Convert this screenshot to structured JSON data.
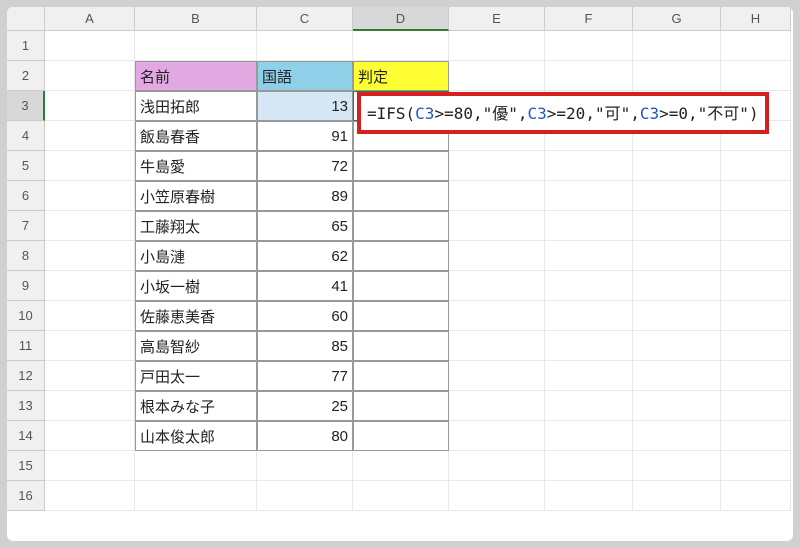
{
  "columns": [
    "A",
    "B",
    "C",
    "D",
    "E",
    "F",
    "G",
    "H"
  ],
  "rows": [
    "1",
    "2",
    "3",
    "4",
    "5",
    "6",
    "7",
    "8",
    "9",
    "10",
    "11",
    "12",
    "13",
    "14",
    "15",
    "16"
  ],
  "active_column": "D",
  "active_row": "3",
  "headers": {
    "name": "名前",
    "score": "国語",
    "judge": "判定"
  },
  "table": [
    {
      "name": "浅田拓郎",
      "score": "13"
    },
    {
      "name": "飯島春香",
      "score": "91"
    },
    {
      "name": "牛島愛",
      "score": "72"
    },
    {
      "name": "小笠原春樹",
      "score": "89"
    },
    {
      "name": "工藤翔太",
      "score": "65"
    },
    {
      "name": "小島漣",
      "score": "62"
    },
    {
      "name": "小坂一樹",
      "score": "41"
    },
    {
      "name": "佐藤恵美香",
      "score": "60"
    },
    {
      "name": "高島智紗",
      "score": "85"
    },
    {
      "name": "戸田太一",
      "score": "77"
    },
    {
      "name": "根本みな子",
      "score": "25"
    },
    {
      "name": "山本俊太郎",
      "score": "80"
    }
  ],
  "formula": {
    "prefix": "=IFS",
    "open": "(",
    "ref": "C3",
    "seg1": ">=80,\"優\",",
    "seg2": ">=20,\"可\",",
    "seg3": ">=0,\"不可\"",
    "close": ")"
  }
}
